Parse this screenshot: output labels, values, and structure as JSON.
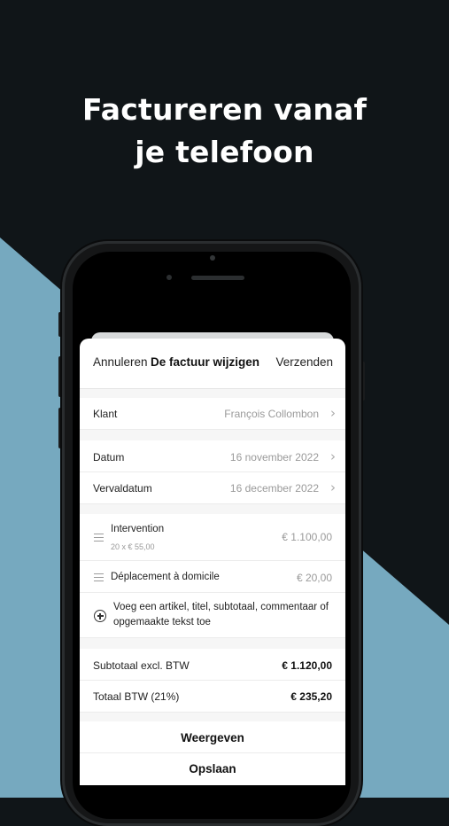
{
  "headline": {
    "line1": "Factureren vanaf",
    "line2": "je telefoon"
  },
  "colors": {
    "dark_bg": "#101518",
    "accent_bg": "#76a9bf"
  },
  "nav": {
    "cancel": "Annuleren",
    "title": "De factuur wijzigen",
    "send": "Verzenden"
  },
  "client": {
    "label": "Klant",
    "value": "François Collombon"
  },
  "dates": [
    {
      "label": "Datum",
      "value": "16 november 2022"
    },
    {
      "label": "Vervaldatum",
      "value": "16 december 2022"
    }
  ],
  "items": [
    {
      "title": "Intervention",
      "detail": "20 x € 55,00",
      "amount": "€ 1.100,00"
    },
    {
      "title": "Déplacement à domicile",
      "detail": "",
      "amount": "€ 20,00"
    }
  ],
  "add_line": {
    "text": "Voeg een artikel, titel, subtotaal, commentaar of opgemaakte tekst toe"
  },
  "totals": [
    {
      "label": "Subtotaal excl. BTW",
      "value": "€ 1.120,00"
    },
    {
      "label": "Totaal BTW (21%)",
      "value": "€ 235,20"
    }
  ],
  "actions": {
    "view": "Weergeven",
    "save": "Opslaan"
  }
}
